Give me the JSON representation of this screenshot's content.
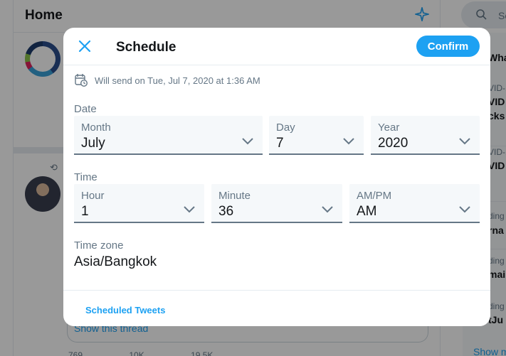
{
  "background": {
    "home_title": "Home",
    "retweet_glyph": "⟲",
    "show_thread": "Show this thread",
    "actions": [
      "769",
      "10K",
      "19.5K",
      ""
    ],
    "search_placeholder": "Se",
    "trends": [
      {
        "category": "What",
        "title": ""
      },
      {
        "category": "VID-1",
        "title": "VID"
      },
      {
        "category": "",
        "title": "cks"
      },
      {
        "category": "VID-1",
        "title": "VID"
      },
      {
        "category": "ding",
        "title": "rna"
      },
      {
        "category": "ding",
        "title": "mai"
      },
      {
        "category": "ding",
        "title": "tJu"
      }
    ],
    "show_more": "Show m"
  },
  "modal": {
    "title": "Schedule",
    "confirm_label": "Confirm",
    "will_send": "Will send on Tue, Jul 7, 2020 at 1:36 AM",
    "date_section_label": "Date",
    "time_section_label": "Time",
    "date_fields": {
      "month": {
        "label": "Month",
        "value": "July"
      },
      "day": {
        "label": "Day",
        "value": "7"
      },
      "year": {
        "label": "Year",
        "value": "2020"
      }
    },
    "time_fields": {
      "hour": {
        "label": "Hour",
        "value": "1"
      },
      "minute": {
        "label": "Minute",
        "value": "36"
      },
      "ampm": {
        "label": "AM/PM",
        "value": "AM"
      }
    },
    "timezone_label": "Time zone",
    "timezone_value": "Asia/Bangkok",
    "scheduled_tweets_link": "Scheduled Tweets"
  },
  "icons": {
    "close": "close-icon",
    "calendar_clock": "calendar-clock-icon",
    "chevron": "chevron-down-icon",
    "sparkle": "sparkle-icon",
    "search": "search-icon"
  },
  "colors": {
    "accent": "#1da1f2",
    "muted_text": "#657786",
    "field_bg": "#f5f8fa"
  }
}
